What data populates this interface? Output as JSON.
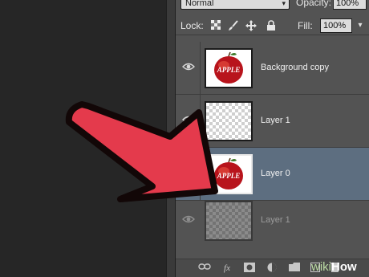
{
  "toolbar": {
    "blend_mode": "Normal",
    "opacity_label": "Opacity:",
    "opacity_value": "100%",
    "lock_label": "Lock:",
    "fill_label": "Fill:",
    "fill_value": "100%",
    "lock_icons": [
      "lock-transparent-icon",
      "lock-paint-brush-icon",
      "lock-move-icon",
      "lock-padlock-icon"
    ]
  },
  "layers": [
    {
      "name": "Background copy",
      "visible": true,
      "thumbnail": "apple",
      "selected": false
    },
    {
      "name": "Layer 1",
      "visible": true,
      "thumbnail": "transparent",
      "selected": false
    },
    {
      "name": "Layer 0",
      "visible": false,
      "thumbnail": "apple",
      "selected": true
    },
    {
      "name": "Layer 1",
      "visible": true,
      "thumbnail": "transparent",
      "selected": false,
      "dragging": true
    }
  ],
  "thumbnail_text": "APPLE",
  "footer_icons": [
    "link-icon",
    "fx-icon",
    "mask-icon",
    "adjustment-icon",
    "folder-icon",
    "new-layer-icon",
    "trash-icon"
  ],
  "watermark": {
    "prefix": "wiki",
    "suffix": "How"
  },
  "colors": {
    "arrow": "#e43a4c",
    "selection": "#5d6e80",
    "panel": "#535353"
  }
}
